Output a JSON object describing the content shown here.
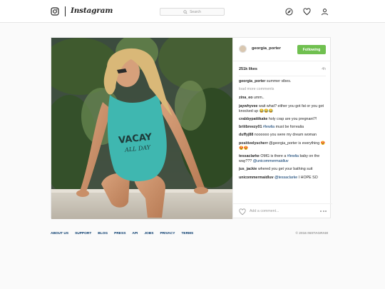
{
  "header": {
    "logo_text": "Instagram",
    "search_placeholder": "Search",
    "icons": [
      "compass-icon",
      "heart-icon",
      "profile-icon"
    ]
  },
  "post": {
    "username": "georgia_porter",
    "follow_label": "Following",
    "likes": "251k likes",
    "age": "4h",
    "caption": {
      "user": "georgia_porter",
      "text": "summer vibes."
    },
    "load_more": "load more comments",
    "comments": [
      {
        "user": "zina_eo",
        "text": "umm.."
      },
      {
        "user": "jaywhyvee",
        "text": "wait what? either you got fat or you got knocked up 😂😂😂"
      },
      {
        "user": "crabbypattikake",
        "text": "holy crap are you pregnant?!"
      },
      {
        "user": "briiibreezy01",
        "mention": "#lewlia",
        "text": "must be forrealia"
      },
      {
        "user": "duffyj88",
        "text": "noooooo you were my dream woman"
      },
      {
        "user": "positivelyscherr",
        "text": "@georgia_porter is everything 😍😍😍"
      },
      {
        "user": "tessaclarke",
        "text": "OMG is there a",
        "mention": "#lewlia",
        "text2": "baby on the way??? ",
        "mention2": "@unicommermaidluv"
      },
      {
        "user": "jus_jackie",
        "text": "whered you get your bathing suit"
      },
      {
        "user": "unicommermaidluv",
        "mention": "@tessaclarke",
        "text": "I HOPE SO"
      }
    ],
    "add_comment_placeholder": "Add a comment..."
  },
  "footer": {
    "links": [
      "ABOUT US",
      "SUPPORT",
      "BLOG",
      "PRESS",
      "API",
      "JOBS",
      "PRIVACY",
      "TERMS"
    ],
    "copyright": "© 2016 INSTAGRAM"
  },
  "colors": {
    "follow_button": "#70c050",
    "link": "#003569",
    "muted": "#999999"
  }
}
